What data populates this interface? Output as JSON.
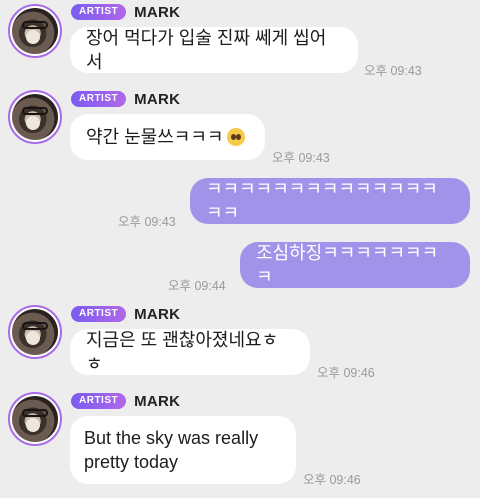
{
  "sender": {
    "badge": "ARTIST",
    "name": "MARK"
  },
  "messages": [
    {
      "text": "장어 먹다가 입술 진짜 쎄게 씹어서",
      "time": "오후 09:43"
    },
    {
      "text": "약간 눈물쓰ㅋㅋㅋ",
      "time": "오후 09:43",
      "emoji": "pleading-face-emoji"
    },
    {
      "text": "ㅋㅋㅋㅋㅋㅋㅋㅋㅋㅋㅋㅋㅋㅋㅋㅋ",
      "time": "오후 09:43"
    },
    {
      "text": "조심하징ㅋㅋㅋㅋㅋㅋㅋㅋ",
      "time": "오후 09:44"
    },
    {
      "text": "지금은 또 괜찮아졌네요ㅎㅎ",
      "time": "오후 09:46"
    },
    {
      "text": "But the sky was really pretty today",
      "time": "오후 09:46"
    }
  ],
  "colors": {
    "background": "#ededed",
    "incoming_bubble": "#ffffff",
    "outgoing_bubble": "#a293ea",
    "badge": "#8a5cf0"
  }
}
